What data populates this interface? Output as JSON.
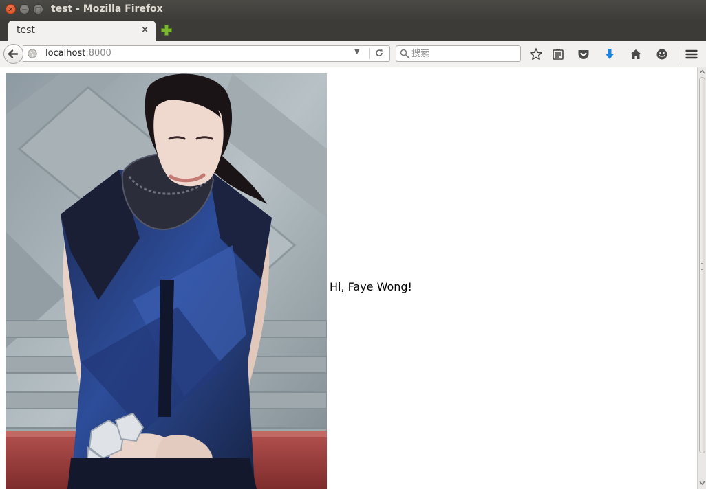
{
  "window": {
    "title": "test - Mozilla Firefox"
  },
  "tabs": [
    {
      "label": "test",
      "close_glyph": "×"
    }
  ],
  "navbar": {
    "url_host": "localhost",
    "url_port": ":8000",
    "search_placeholder": "搜索"
  },
  "toolbar_icons": [
    "star-icon",
    "reading-list-icon",
    "pocket-icon",
    "download-icon",
    "home-icon",
    "hello-icon",
    "menu-icon"
  ],
  "content": {
    "greeting": "Hi, Faye Wong!"
  },
  "colors": {
    "titlebar": "#3e3d39",
    "close_button": "#e45a2a",
    "download_arrow": "#1a86e0",
    "new_tab_plus": "#7cb82f"
  }
}
